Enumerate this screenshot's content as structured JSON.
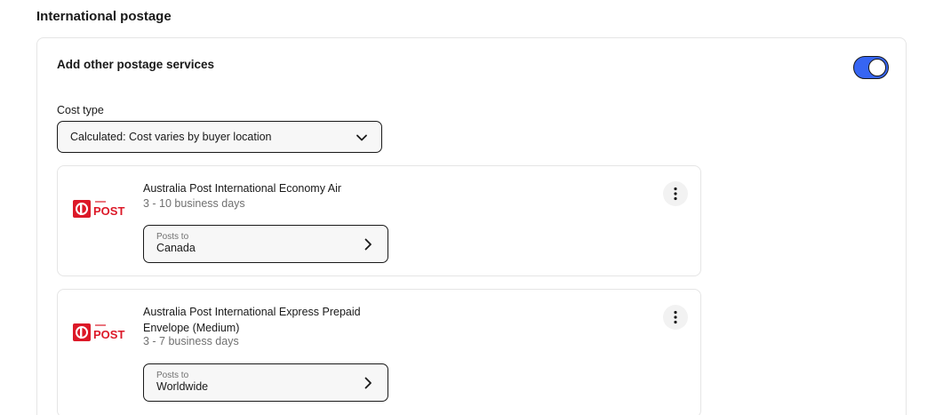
{
  "section": {
    "title": "International postage"
  },
  "panel": {
    "heading": "Add other postage services",
    "toggle_on": true,
    "cost_type_label": "Cost type",
    "cost_type_value": "Calculated: Cost varies by buyer location"
  },
  "services": [
    {
      "logo": "POST",
      "name": "Australia Post International Economy Air",
      "days": "3 - 10 business days",
      "posts_to_label": "Posts to",
      "posts_to_value": "Canada"
    },
    {
      "logo": "POST",
      "name": "Australia Post International Express Prepaid Envelope (Medium)",
      "days": "3 - 7 business days",
      "posts_to_label": "Posts to",
      "posts_to_value": "Worldwide"
    }
  ],
  "icons": {
    "toggle": "toggle-switch",
    "dropdown": "chevron-down-icon",
    "more": "more-vertical-icon",
    "next": "chevron-right-icon",
    "logo": "australia-post-logo-icon"
  },
  "colors": {
    "accent": "#3665f3",
    "brand_red": "#dc1928",
    "text": "#191919",
    "muted": "#707070",
    "border": "#e5e5e5"
  }
}
